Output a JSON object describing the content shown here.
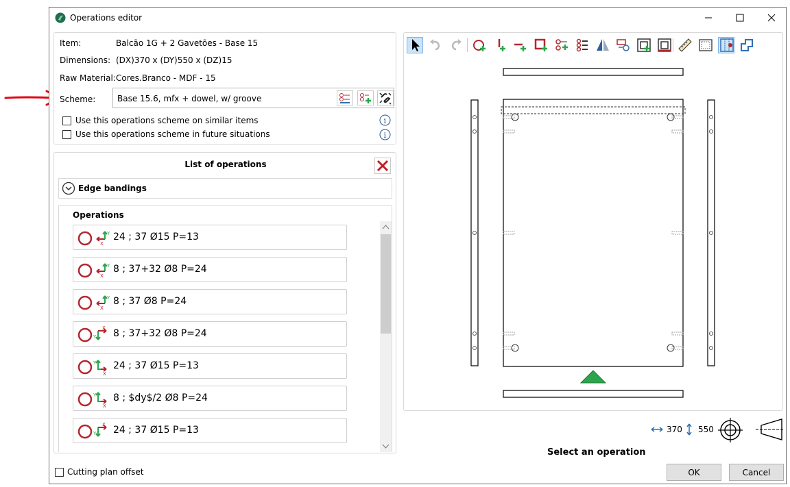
{
  "window": {
    "title": "Operations editor"
  },
  "info": {
    "item_label": "Item:",
    "item_value": "Balcão 1G + 2 Gavetões - Base 15",
    "dimensions_label": "Dimensions:",
    "dimensions_value": "(DX)370 x (DY)550 x (DZ)15",
    "raw_material_label": "Raw Material:",
    "raw_material_value": "Cores.Branco - MDF - 15",
    "scheme_label": "Scheme:",
    "scheme_value": "Base 15.6, mfx + dowel, w/ groove",
    "use_similar_label": "Use this operations scheme on similar items",
    "use_future_label": "Use this operations scheme in future situations"
  },
  "list": {
    "title": "List of operations",
    "edge_bandings_label": "Edge bandings",
    "operations_label": "Operations",
    "operations": [
      {
        "text": "24 ; 37 Ø15 P=13",
        "axis": "left"
      },
      {
        "text": "8 ; 37+32 Ø8 P=24",
        "axis": "left"
      },
      {
        "text": "8 ; 37 Ø8 P=24",
        "axis": "left"
      },
      {
        "text": "8 ; 37+32 Ø8 P=24",
        "axis": "down"
      },
      {
        "text": "24 ; 37 Ø15 P=13",
        "axis": "right"
      },
      {
        "text": "8 ; $dy$/2 Ø8 P=24",
        "axis": "right"
      },
      {
        "text": "24 ; 37 Ø15 P=13",
        "axis": "down"
      }
    ]
  },
  "footer": {
    "cutting_plan_label": "Cutting plan offset",
    "dim_x": "370",
    "dim_y": "550",
    "status": "Select an operation",
    "ok_label": "OK",
    "cancel_label": "Cancel"
  },
  "colors": {
    "accent_red": "#b5262e",
    "accent_green": "#2ea44f",
    "selected_tool": "#cce4f7"
  }
}
